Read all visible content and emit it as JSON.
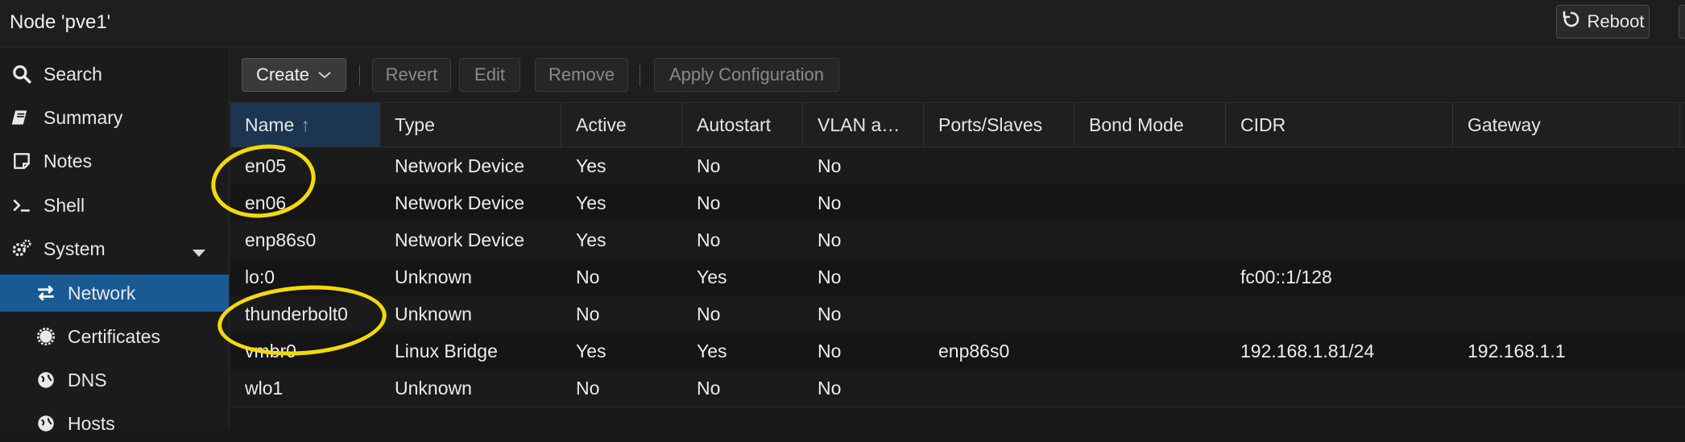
{
  "header": {
    "title": "Node 'pve1'",
    "reboot_label": "Reboot"
  },
  "sidebar": {
    "items": [
      {
        "label": "Search",
        "icon": "search-icon"
      },
      {
        "label": "Summary",
        "icon": "book-icon"
      },
      {
        "label": "Notes",
        "icon": "sticky-note-icon"
      },
      {
        "label": "Shell",
        "icon": "terminal-icon"
      },
      {
        "label": "System",
        "icon": "cogs-icon"
      },
      {
        "label": "Network",
        "icon": "exchange-icon"
      },
      {
        "label": "Certificates",
        "icon": "certificate-icon"
      },
      {
        "label": "DNS",
        "icon": "globe-icon"
      },
      {
        "label": "Hosts",
        "icon": "globe-icon"
      }
    ]
  },
  "toolbar": {
    "create_label": "Create",
    "revert_label": "Revert",
    "edit_label": "Edit",
    "remove_label": "Remove",
    "apply_label": "Apply Configuration"
  },
  "table": {
    "columns": [
      "Name",
      "Type",
      "Active",
      "Autostart",
      "VLAN a…",
      "Ports/Slaves",
      "Bond Mode",
      "CIDR",
      "Gateway"
    ],
    "sort_arrow": "↑",
    "rows": [
      [
        "en05",
        "Network Device",
        "Yes",
        "No",
        "No",
        "",
        "",
        "",
        ""
      ],
      [
        "en06",
        "Network Device",
        "Yes",
        "No",
        "No",
        "",
        "",
        "",
        ""
      ],
      [
        "enp86s0",
        "Network Device",
        "Yes",
        "No",
        "No",
        "",
        "",
        "",
        ""
      ],
      [
        "lo:0",
        "Unknown",
        "No",
        "Yes",
        "No",
        "",
        "",
        "fc00::1/128",
        ""
      ],
      [
        "thunderbolt0",
        "Unknown",
        "No",
        "No",
        "No",
        "",
        "",
        "",
        ""
      ],
      [
        "vmbr0",
        "Linux Bridge",
        "Yes",
        "Yes",
        "No",
        "enp86s0",
        "",
        "192.168.1.81/24",
        "192.168.1.1"
      ],
      [
        "wlo1",
        "Unknown",
        "No",
        "No",
        "No",
        "",
        "",
        "",
        ""
      ]
    ]
  },
  "colors": {
    "selected_nav": "#1a5a94",
    "annotation": "#f5d90a"
  }
}
